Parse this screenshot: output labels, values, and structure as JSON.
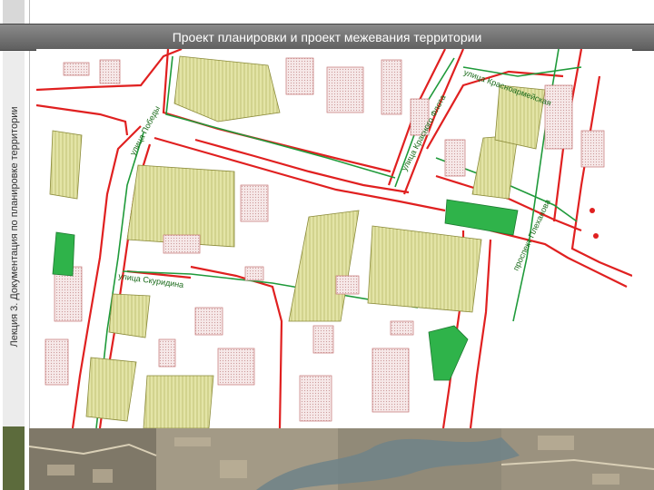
{
  "header": {
    "title": "Проект планировки и проект межевания территории"
  },
  "sidebar": {
    "label": "Лекция 3. Документация по планировке территории"
  },
  "map": {
    "street_labels": {
      "pobedy": "улица Победы",
      "skuridina": "улица Скуридина",
      "krasno_flota": "улица Красного Флота",
      "krasnoarmeyskaya": "улица Красноармейская",
      "prospekt": "проспект Плеханова"
    },
    "colors": {
      "red_line": "#e02020",
      "green_line": "#1f9a3a",
      "green_area": "#2fb34a",
      "olive_area": "#d9dc9a",
      "building": "#f3dede"
    }
  }
}
